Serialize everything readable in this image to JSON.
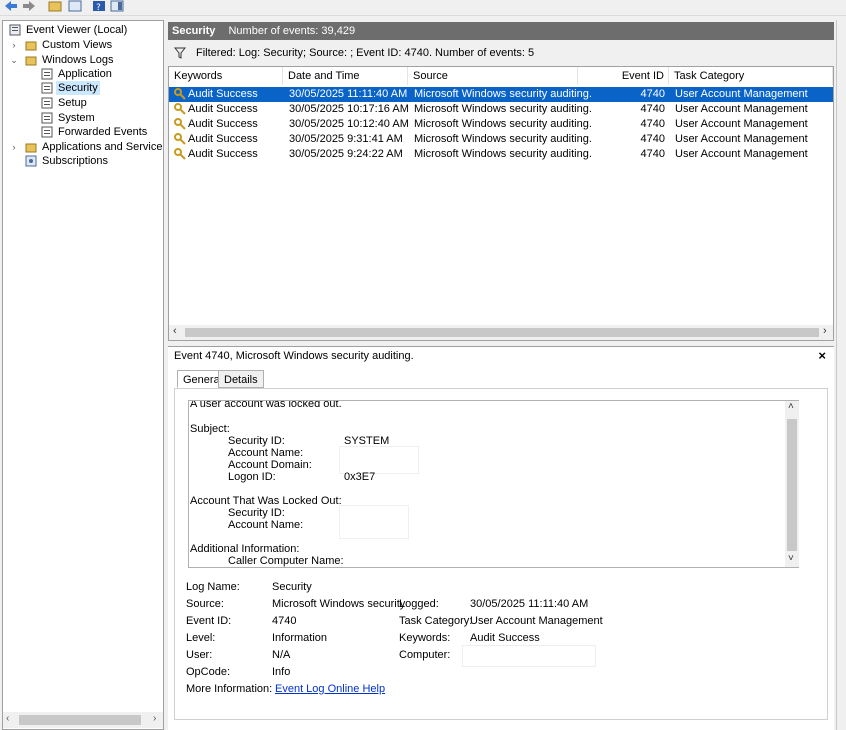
{
  "tree": {
    "root": "Event Viewer (Local)",
    "custom_views": "Custom Views",
    "windows_logs": "Windows Logs",
    "application": "Application",
    "security": "Security",
    "setup": "Setup",
    "system": "System",
    "forwarded": "Forwarded Events",
    "apps_services": "Applications and Services Lo",
    "subscriptions": "Subscriptions"
  },
  "header": {
    "title": "Security",
    "count": "Number of events: 39,429"
  },
  "filter": {
    "text": "Filtered: Log: Security; Source: ; Event ID: 4740. Number of events: 5"
  },
  "grid": {
    "columns": [
      "Keywords",
      "Date and Time",
      "Source",
      "Event ID",
      "Task Category"
    ],
    "rows": [
      {
        "kw": "Audit Success",
        "dt": "30/05/2025 11:11:40 AM",
        "src": "Microsoft Windows security auditing.",
        "id": "4740",
        "cat": "User Account Management"
      },
      {
        "kw": "Audit Success",
        "dt": "30/05/2025 10:17:16 AM",
        "src": "Microsoft Windows security auditing.",
        "id": "4740",
        "cat": "User Account Management"
      },
      {
        "kw": "Audit Success",
        "dt": "30/05/2025 10:12:40 AM",
        "src": "Microsoft Windows security auditing.",
        "id": "4740",
        "cat": "User Account Management"
      },
      {
        "kw": "Audit Success",
        "dt": "30/05/2025 9:31:41 AM",
        "src": "Microsoft Windows security auditing.",
        "id": "4740",
        "cat": "User Account Management"
      },
      {
        "kw": "Audit Success",
        "dt": "30/05/2025 9:24:22 AM",
        "src": "Microsoft Windows security auditing.",
        "id": "4740",
        "cat": "User Account Management"
      }
    ]
  },
  "details": {
    "title": "Event 4740, Microsoft Windows security auditing.",
    "close": "×",
    "tab_general": "General",
    "tab_details": "Details",
    "desc": {
      "intro": "A user account was locked out.",
      "subject": "Subject:",
      "sid_label": "Security ID:",
      "sid_value": "SYSTEM",
      "acct_name_label": "Account Name:",
      "acct_domain_label": "Account Domain:",
      "logon_label": "Logon ID:",
      "logon_value": "0x3E7",
      "locked_header": "Account That Was Locked Out:",
      "locked_sid_label": "Security ID:",
      "locked_name_label": "Account Name:",
      "additional": "Additional Information:",
      "caller": "Caller Computer Name:"
    },
    "fields": {
      "log_name_label": "Log Name:",
      "log_name": "Security",
      "source_label": "Source:",
      "source": "Microsoft Windows security",
      "logged_label": "Logged:",
      "logged": "30/05/2025 11:11:40 AM",
      "event_id_label": "Event ID:",
      "event_id": "4740",
      "task_label": "Task Category:",
      "task": "User Account Management",
      "level_label": "Level:",
      "level": "Information",
      "keywords_label": "Keywords:",
      "keywords": "Audit Success",
      "user_label": "User:",
      "user": "N/A",
      "computer_label": "Computer:",
      "opcode_label": "OpCode:",
      "opcode": "Info",
      "more_label": "More Information:",
      "more_link": "Event Log Online Help"
    }
  },
  "colors": {
    "selection": "#0a64c8",
    "header": "#6d6d6d",
    "link": "#0033cc"
  }
}
